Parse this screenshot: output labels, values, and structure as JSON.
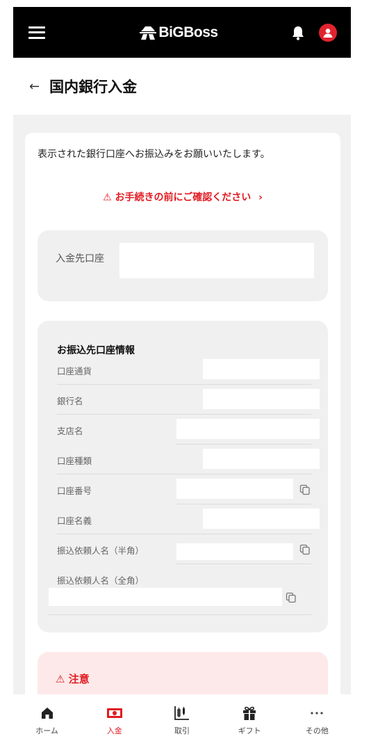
{
  "header": {
    "logo_text": "BiGBoss"
  },
  "page": {
    "title": "国内銀行入金"
  },
  "intro": "表示された銀行口座へお振込みをお願いいたします。",
  "warning_link": "お手続きの前にご確認ください",
  "deposit": {
    "label": "入金先口座"
  },
  "transfer_info": {
    "title": "お振込先口座情報",
    "rows": [
      {
        "label": "口座通貨"
      },
      {
        "label": "銀行名"
      },
      {
        "label": "支店名"
      },
      {
        "label": "口座種類"
      },
      {
        "label": "口座番号"
      },
      {
        "label": "口座名義"
      },
      {
        "label": "振込依頼人名（半角）"
      },
      {
        "label": "振込依頼人名（全角）"
      }
    ]
  },
  "notice": {
    "title": "注意"
  },
  "nav": [
    {
      "label": "ホーム",
      "icon": "home-icon"
    },
    {
      "label": "入金",
      "icon": "deposit-icon"
    },
    {
      "label": "取引",
      "icon": "trade-icon"
    },
    {
      "label": "ギフト",
      "icon": "gift-icon"
    },
    {
      "label": "その他",
      "icon": "more-icon"
    }
  ],
  "colors": {
    "accent": "#e11b22",
    "header_bg": "#000000",
    "panel_bg": "#f0f0f0",
    "notice_bg": "#fde9e9"
  }
}
